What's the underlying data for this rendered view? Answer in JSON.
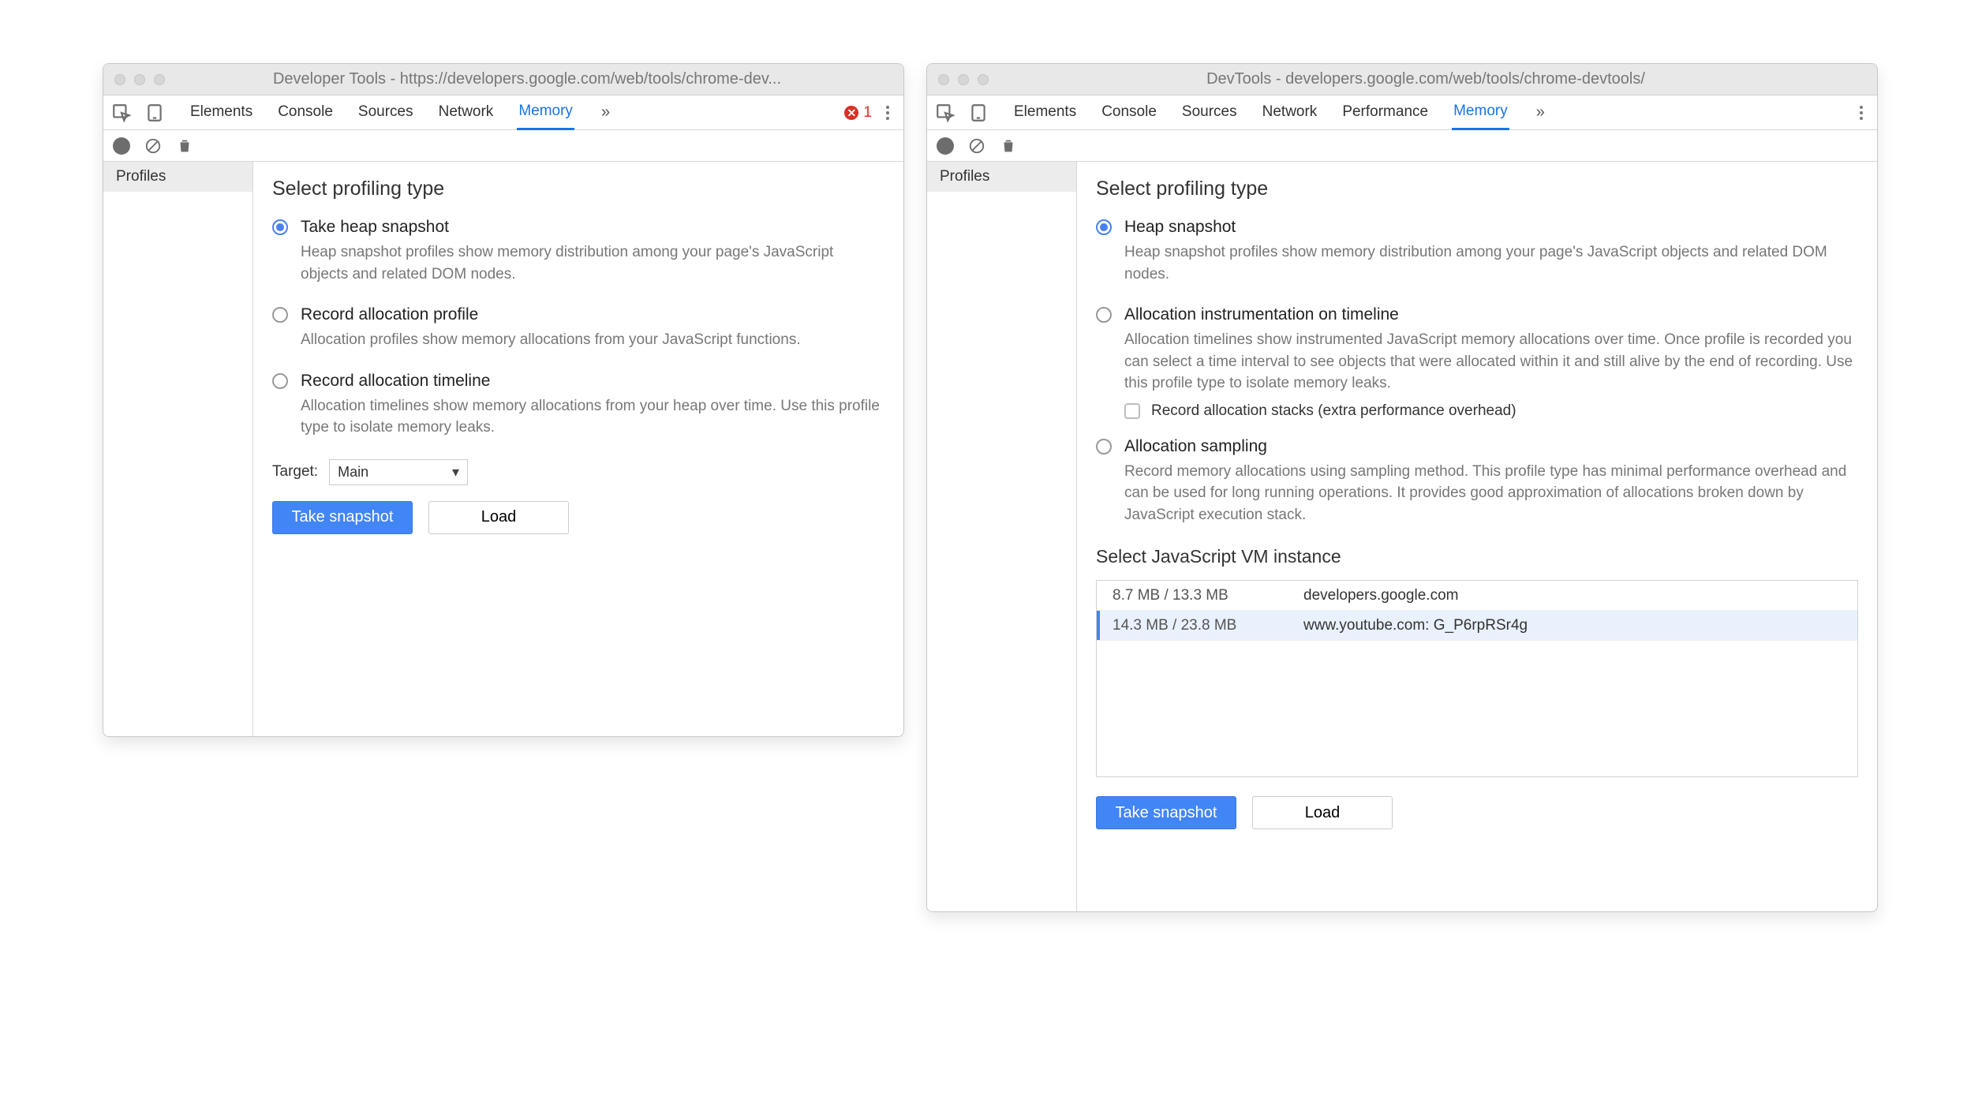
{
  "window1": {
    "title": "Developer Tools - https://developers.google.com/web/tools/chrome-dev...",
    "tabs": {
      "elements": "Elements",
      "console": "Console",
      "sources": "Sources",
      "network": "Network",
      "memory": "Memory"
    },
    "errors": "1",
    "sidebar": {
      "profiles": "Profiles"
    },
    "main": {
      "heading": "Select profiling type",
      "options": [
        {
          "title": "Take heap snapshot",
          "desc": "Heap snapshot profiles show memory distribution among your page's JavaScript objects and related DOM nodes."
        },
        {
          "title": "Record allocation profile",
          "desc": "Allocation profiles show memory allocations from your JavaScript functions."
        },
        {
          "title": "Record allocation timeline",
          "desc": "Allocation timelines show memory allocations from your heap over time. Use this profile type to isolate memory leaks."
        }
      ],
      "target_label": "Target:",
      "target_value": "Main",
      "buttons": {
        "primary": "Take snapshot",
        "secondary": "Load"
      }
    }
  },
  "window2": {
    "title": "DevTools - developers.google.com/web/tools/chrome-devtools/",
    "tabs": {
      "elements": "Elements",
      "console": "Console",
      "sources": "Sources",
      "network": "Network",
      "performance": "Performance",
      "memory": "Memory"
    },
    "sidebar": {
      "profiles": "Profiles"
    },
    "main": {
      "heading": "Select profiling type",
      "options": [
        {
          "title": "Heap snapshot",
          "desc": "Heap snapshot profiles show memory distribution among your page's JavaScript objects and related DOM nodes."
        },
        {
          "title": "Allocation instrumentation on timeline",
          "desc": "Allocation timelines show instrumented JavaScript memory allocations over time. Once profile is recorded you can select a time interval to see objects that were allocated within it and still alive by the end of recording. Use this profile type to isolate memory leaks."
        },
        {
          "title": "Allocation sampling",
          "desc": "Record memory allocations using sampling method. This profile type has minimal performance overhead and can be used for long running operations. It provides good approximation of allocations broken down by JavaScript execution stack."
        }
      ],
      "suboption_label": "Record allocation stacks (extra performance overhead)",
      "vm_heading": "Select JavaScript VM instance",
      "vm_rows": [
        {
          "mem": "8.7 MB / 13.3 MB",
          "name": "developers.google.com"
        },
        {
          "mem": "14.3 MB / 23.8 MB",
          "name": "www.youtube.com: G_P6rpRSr4g"
        }
      ],
      "buttons": {
        "primary": "Take snapshot",
        "secondary": "Load"
      }
    }
  }
}
